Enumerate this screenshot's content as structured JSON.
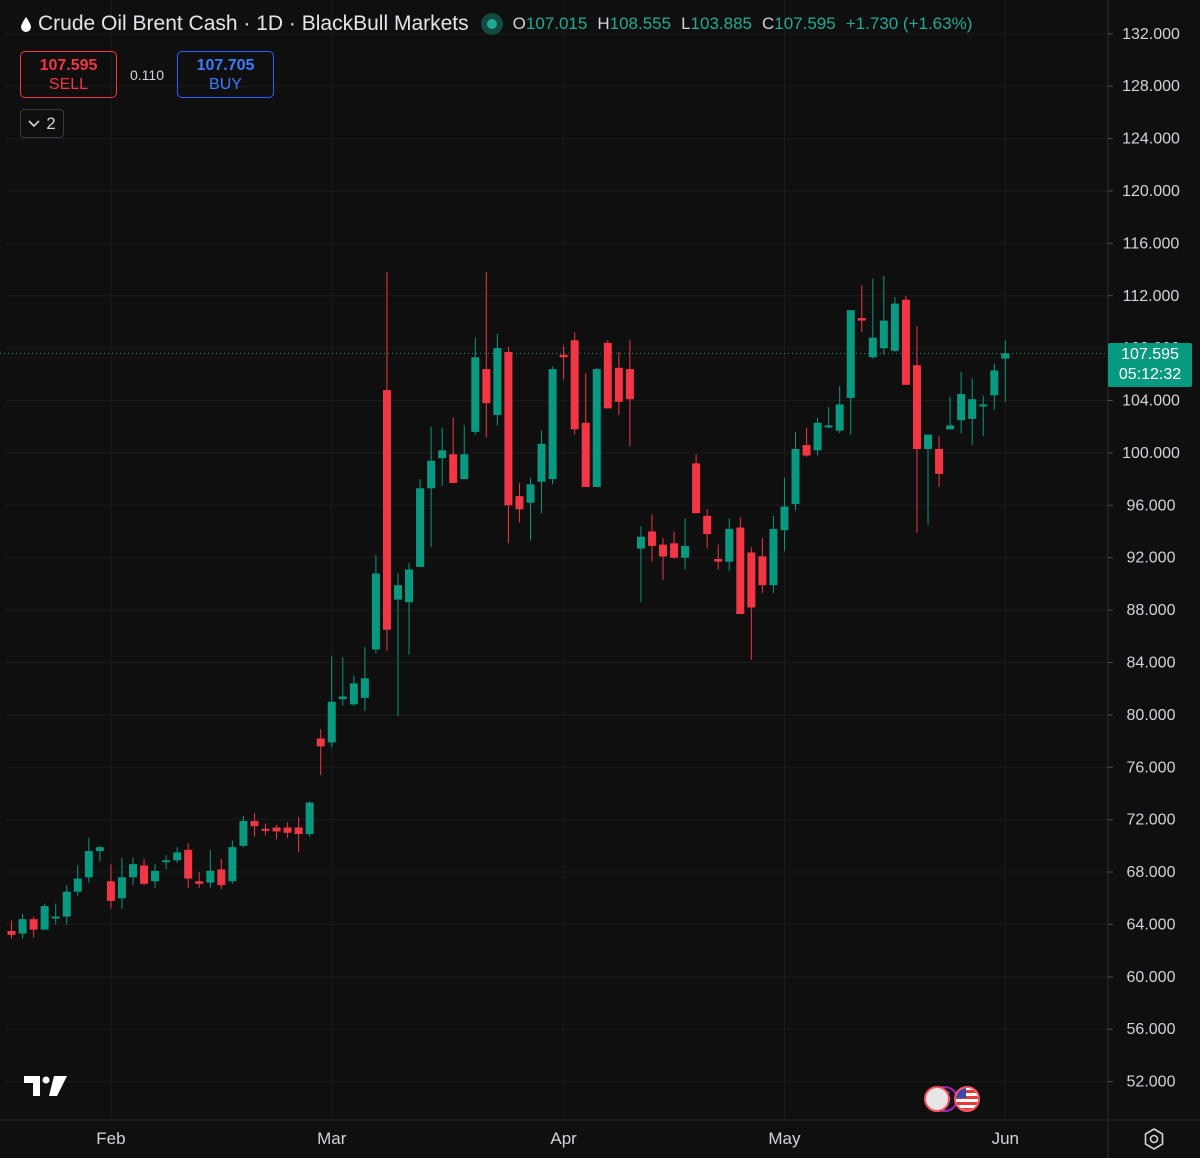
{
  "header": {
    "title": "Crude Oil Brent Cash · 1D · BlackBull Markets",
    "ohlc": {
      "o_label": "O",
      "o_value": "107.015",
      "h_label": "H",
      "h_value": "108.555",
      "l_label": "L",
      "l_value": "103.885",
      "c_label": "C",
      "c_value": "107.595",
      "change": "+1.730 (+1.63%)"
    }
  },
  "trade": {
    "sell_price": "107.595",
    "sell_label": "SELL",
    "spread": "0.110",
    "buy_price": "107.705",
    "buy_label": "BUY"
  },
  "indicators_toggle": {
    "count": "2"
  },
  "price_tag": {
    "price": "107.595",
    "countdown": "05:12:32"
  },
  "colors": {
    "up": "#089981",
    "down": "#f23645",
    "background": "#0f0f0f",
    "grid": "#1c1c1c",
    "text": "#d1d4dc"
  },
  "icons": [
    "oil-drop-icon",
    "market-status-icon",
    "chevron-down-icon",
    "tradingview-logo-icon",
    "lightning-icon",
    "us-flag-icon",
    "settings-gear-icon"
  ],
  "chart_data": {
    "type": "candlestick",
    "symbol": "Crude Oil Brent Cash",
    "interval": "1D",
    "ylim": [
      50,
      134
    ],
    "y_ticks": [
      "132.000",
      "128.000",
      "124.000",
      "120.000",
      "116.000",
      "112.000",
      "108.000",
      "104.000",
      "100.000",
      "96.000",
      "92.000",
      "88.000",
      "84.000",
      "80.000",
      "76.000",
      "72.000",
      "68.000",
      "64.000",
      "60.000",
      "56.000",
      "52.000"
    ],
    "x_ticks": [
      "Feb",
      "Mar",
      "Apr",
      "May",
      "Jun"
    ],
    "x_tick_index": [
      9,
      29,
      50,
      70,
      90
    ],
    "x_range": [
      -0.5,
      99.3
    ],
    "last_price": 107.595,
    "candles": [
      [
        63.5,
        64.3,
        62.9,
        63.2
      ],
      [
        63.3,
        64.8,
        62.9,
        64.4
      ],
      [
        64.4,
        64.6,
        63.0,
        63.6
      ],
      [
        63.6,
        65.6,
        63.6,
        65.4
      ],
      [
        64.6,
        65.6,
        64.0,
        64.6
      ],
      [
        64.6,
        67.0,
        64.0,
        66.5
      ],
      [
        66.5,
        68.5,
        66.2,
        67.5
      ],
      [
        67.6,
        70.6,
        67.2,
        69.6
      ],
      [
        69.6,
        70.0,
        68.8,
        69.9
      ],
      [
        67.3,
        68.6,
        65.2,
        65.8
      ],
      [
        66.0,
        69.1,
        65.2,
        67.6
      ],
      [
        67.6,
        69.1,
        67.0,
        68.6
      ],
      [
        68.5,
        69.0,
        67.0,
        67.1
      ],
      [
        67.3,
        68.6,
        66.8,
        68.1
      ],
      [
        68.8,
        69.3,
        68.2,
        68.9
      ],
      [
        68.9,
        69.9,
        68.7,
        69.5
      ],
      [
        69.7,
        70.2,
        66.8,
        67.5
      ],
      [
        67.3,
        68.0,
        66.8,
        67.1
      ],
      [
        67.2,
        69.7,
        66.8,
        68.1
      ],
      [
        68.2,
        69.0,
        66.7,
        67.0
      ],
      [
        67.3,
        70.4,
        67.1,
        69.9
      ],
      [
        70.0,
        72.3,
        69.9,
        71.9
      ],
      [
        71.9,
        72.5,
        70.7,
        71.5
      ],
      [
        71.3,
        71.7,
        70.8,
        71.2
      ],
      [
        71.4,
        71.6,
        70.5,
        71.1
      ],
      [
        71.4,
        71.8,
        70.6,
        71.0
      ],
      [
        71.4,
        72.2,
        69.5,
        70.9
      ],
      [
        70.9,
        73.4,
        70.7,
        73.3
      ],
      [
        78.2,
        78.9,
        75.4,
        77.6
      ],
      [
        77.9,
        84.5,
        77.5,
        81.0
      ],
      [
        81.2,
        84.4,
        80.7,
        81.4
      ],
      [
        80.8,
        83.0,
        80.7,
        82.4
      ],
      [
        81.3,
        85.2,
        80.3,
        82.8
      ],
      [
        85.0,
        92.2,
        84.7,
        90.8
      ],
      [
        104.8,
        113.8,
        84.9,
        86.5
      ],
      [
        88.8,
        90.8,
        79.9,
        89.9
      ],
      [
        88.6,
        91.6,
        84.6,
        91.1
      ],
      [
        91.3,
        98.0,
        91.3,
        97.3
      ],
      [
        97.3,
        102.0,
        92.8,
        99.4
      ],
      [
        99.6,
        101.9,
        97.5,
        100.2
      ],
      [
        99.9,
        102.7,
        97.9,
        97.7
      ],
      [
        98.0,
        102.1,
        98.9,
        99.9
      ],
      [
        101.6,
        108.8,
        101.4,
        107.3
      ],
      [
        106.4,
        113.8,
        101.2,
        103.8
      ],
      [
        102.9,
        109.1,
        102.1,
        108.0
      ],
      [
        107.7,
        108.1,
        93.1,
        96.0
      ],
      [
        96.7,
        97.7,
        94.7,
        95.7
      ],
      [
        96.2,
        98.1,
        93.3,
        97.6
      ],
      [
        97.8,
        101.7,
        95.4,
        100.7
      ],
      [
        98.0,
        106.6,
        97.6,
        106.4
      ],
      [
        107.5,
        108.2,
        105.6,
        107.3
      ],
      [
        108.6,
        109.2,
        101.4,
        101.8
      ],
      [
        102.3,
        106.1,
        97.5,
        97.4
      ],
      [
        97.4,
        106.5,
        97.5,
        106.4
      ],
      [
        108.4,
        108.6,
        103.5,
        103.4
      ],
      [
        106.5,
        107.7,
        102.9,
        103.9
      ],
      [
        106.4,
        108.6,
        100.5,
        104.1
      ],
      [
        92.7,
        94.4,
        88.6,
        93.6
      ],
      [
        94.0,
        95.3,
        91.7,
        92.9
      ],
      [
        93.0,
        93.5,
        90.3,
        92.1
      ],
      [
        93.1,
        94.0,
        91.9,
        92.0
      ],
      [
        92.0,
        95.0,
        91.1,
        92.9
      ],
      [
        99.2,
        99.9,
        95.5,
        95.4
      ],
      [
        95.2,
        95.7,
        92.7,
        93.8
      ],
      [
        91.9,
        93.0,
        91.1,
        91.7
      ],
      [
        91.7,
        95.0,
        91.0,
        94.2
      ],
      [
        94.3,
        95.1,
        88.6,
        87.7
      ],
      [
        92.4,
        92.8,
        84.2,
        88.2
      ],
      [
        92.1,
        93.5,
        89.3,
        89.9
      ],
      [
        89.9,
        95.2,
        89.3,
        94.2
      ],
      [
        94.1,
        98.1,
        92.5,
        95.9
      ],
      [
        96.1,
        101.6,
        95.6,
        100.3
      ],
      [
        100.6,
        101.9,
        99.7,
        99.8
      ],
      [
        100.2,
        102.7,
        99.8,
        102.3
      ],
      [
        102.0,
        103.5,
        101.9,
        102.1
      ],
      [
        101.7,
        105.1,
        101.5,
        103.7
      ],
      [
        104.2,
        108.3,
        101.4,
        110.9
      ],
      [
        110.3,
        112.8,
        109.2,
        110.1
      ],
      [
        107.3,
        113.3,
        107.2,
        108.8
      ],
      [
        108.0,
        113.5,
        107.5,
        110.1
      ],
      [
        107.8,
        111.9,
        107.7,
        111.4
      ],
      [
        111.7,
        112.0,
        105.3,
        105.2
      ],
      [
        106.7,
        109.7,
        93.9,
        100.3
      ],
      [
        100.3,
        101.0,
        94.5,
        101.4
      ],
      [
        100.3,
        101.3,
        97.4,
        98.4
      ],
      [
        101.8,
        104.3,
        102.1,
        102.1
      ],
      [
        102.5,
        106.2,
        101.5,
        104.5
      ],
      [
        102.6,
        105.7,
        100.6,
        104.1
      ],
      [
        103.7,
        104.4,
        101.3,
        103.7
      ],
      [
        104.4,
        106.8,
        103.3,
        106.3
      ],
      [
        107.2,
        108.6,
        103.9,
        107.6
      ]
    ]
  }
}
